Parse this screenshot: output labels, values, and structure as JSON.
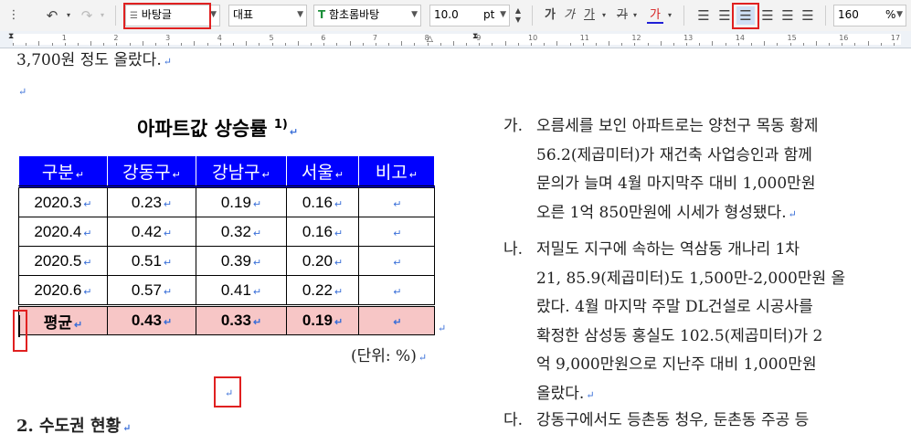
{
  "toolbar": {
    "style_value": "바탕글",
    "style_icon": "paragraph-style-icon",
    "language_value": "대표",
    "font_value": "함초롬바탕",
    "font_icon": "truetype-font-icon",
    "size_value": "10.0",
    "size_unit": "pt",
    "bold_label": "가",
    "italic_label": "가",
    "underline_label": "가",
    "strike_label": "가",
    "color_label": "가",
    "zoom_value": "160",
    "zoom_unit": "%",
    "undo_icon": "undo-icon",
    "redo_icon": "redo-icon",
    "align_icons": [
      "align-justify-icon",
      "align-left-icon",
      "align-center-icon",
      "align-right-icon",
      "align-distribute-icon",
      "align-divide-icon"
    ],
    "accent_red": "#e02020",
    "text_color_accent": "#d62020"
  },
  "ruler": {
    "numbers": [
      "1",
      "2",
      "3",
      "4",
      "5",
      "6",
      "7",
      "8",
      "9",
      "10",
      "11",
      "12",
      "13",
      "14",
      "15",
      "16",
      "17"
    ]
  },
  "document": {
    "top_line": "3,700원 정도 올랐다.",
    "paragraph_mark": "↵",
    "table_title": "아파트값 상승률",
    "table_title_sup": "1)",
    "table": {
      "headers": [
        "구분",
        "강동구",
        "강남구",
        "서울",
        "비고"
      ],
      "rows": [
        [
          "2020.3",
          "0.23",
          "0.19",
          "0.16",
          ""
        ],
        [
          "2020.4",
          "0.42",
          "0.32",
          "0.16",
          ""
        ],
        [
          "2020.5",
          "0.51",
          "0.39",
          "0.20",
          ""
        ],
        [
          "2020.6",
          "0.57",
          "0.41",
          "0.22",
          ""
        ]
      ],
      "avg_row": [
        "평균",
        "0.43",
        "0.33",
        "0.19",
        ""
      ],
      "header_bg": "#0000ff",
      "avg_bg": "#f7c6c6"
    },
    "unit_note": "(단위: %)",
    "section_heading": "2. 수도권 현황",
    "list_items": [
      {
        "label": "가.",
        "lines": [
          "오름세를 보인 아파트로는 양천구 목동 황제",
          "56.2(제곱미터)가 재건축 사업승인과 함께",
          "문의가 늘며 4월 마지막주 대비 1,000만원",
          "오른 1억 850만원에 시세가 형성됐다."
        ]
      },
      {
        "label": "나.",
        "lines": [
          "저밀도 지구에 속하는 역삼동 개나리 1차",
          "21, 85.9(제곱미터)도 1,500만-2,000만원 올",
          "랐다. 4월 마지막 주말 DL건설로 시공사를",
          "확정한 삼성동 홍실도 102.5(제곱미터)가 2",
          "억 9,000만원으로 지난주 대비 1,000만원",
          "올랐다."
        ]
      },
      {
        "label": "다.",
        "lines": [
          "강동구에서도 등촌동 청우, 둔촌동 주공 등"
        ]
      }
    ]
  }
}
